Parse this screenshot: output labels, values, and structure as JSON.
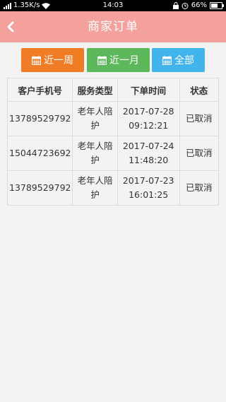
{
  "status_bar": {
    "network": "1.35K/s",
    "time": "14:03",
    "battery": "66%",
    "battery_level": 0.66
  },
  "header": {
    "title": "商家订单",
    "back_icon": "chevron-left-icon"
  },
  "filters": {
    "week": "近一周",
    "month": "近一月",
    "all": "全部",
    "icon": "calendar-icon",
    "colors": {
      "week": "#f07c26",
      "month": "#5db85c",
      "all": "#42b4ec"
    }
  },
  "table": {
    "headers": [
      "客户手机号",
      "服务类型",
      "下单时间",
      "状态"
    ],
    "rows": [
      {
        "phone": "13789529792",
        "service_line1": "老年人陪",
        "service_line2": "护",
        "date": "2017-07-28",
        "time": "09:12:21",
        "status": "已取消"
      },
      {
        "phone": "15044723692",
        "service_line1": "老年人陪",
        "service_line2": "护",
        "date": "2017-07-24",
        "time": "11:48:20",
        "status": "已取消"
      },
      {
        "phone": "13789529792",
        "service_line1": "老年人陪",
        "service_line2": "护",
        "date": "2017-07-23",
        "time": "16:01:25",
        "status": "已取消"
      }
    ]
  },
  "colors": {
    "header": "#f4a09d",
    "background": "#f3f3f3"
  }
}
